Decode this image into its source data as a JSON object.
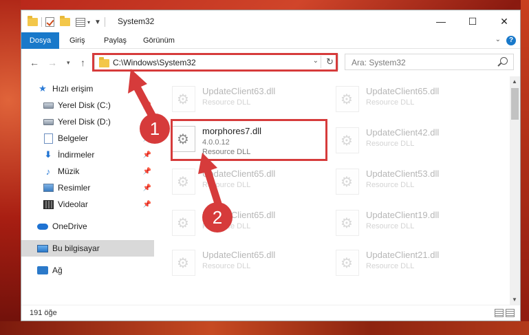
{
  "window": {
    "title": "System32",
    "controls": {
      "minimize": "—",
      "maximize": "☐",
      "close": "✕"
    }
  },
  "ribbon": {
    "tabs": [
      "Dosya",
      "Giriş",
      "Paylaş",
      "Görünüm"
    ],
    "help": "?"
  },
  "address": {
    "path": "C:\\Windows\\System32",
    "search_placeholder": "Ara: System32"
  },
  "navpane": {
    "items": [
      {
        "label": "Hızlı erişim",
        "icon": "star-icon"
      },
      {
        "label": "Yerel Disk (C:)",
        "icon": "drive-icon",
        "pinned": true
      },
      {
        "label": "Yerel Disk (D:)",
        "icon": "drive-icon",
        "pinned": true
      },
      {
        "label": "Belgeler",
        "icon": "documents-icon",
        "pinned": true
      },
      {
        "label": "İndirmeler",
        "icon": "downloads-icon",
        "pinned": true
      },
      {
        "label": "Müzik",
        "icon": "music-icon",
        "pinned": true
      },
      {
        "label": "Resimler",
        "icon": "pictures-icon",
        "pinned": true
      },
      {
        "label": "Videolar",
        "icon": "videos-icon",
        "pinned": true
      },
      {
        "label": "OneDrive",
        "icon": "onedrive-icon"
      },
      {
        "label": "Bu bilgisayar",
        "icon": "this-pc-icon",
        "selected": true
      },
      {
        "label": "Ağ",
        "icon": "network-icon"
      }
    ]
  },
  "files": {
    "selected": {
      "name": "morphores7.dll",
      "version": "4.0.0.12",
      "type": "Resource DLL"
    },
    "ghosts": [
      {
        "name": "UpdateClient63.dll",
        "type": "Resource DLL"
      },
      {
        "name": "UpdateClient65.dll",
        "type": "Resource DLL"
      },
      {
        "name": "UpdateClient42.dll",
        "type": "Resource DLL"
      },
      {
        "name": "UpdateClient65.dll",
        "type": "Resource DLL"
      },
      {
        "name": "UpdateClient53.dll",
        "type": "Resource DLL"
      },
      {
        "name": "UpdateClient65.dll",
        "type": "Resource DLL"
      },
      {
        "name": "UpdateClient19.dll",
        "type": "Resource DLL"
      },
      {
        "name": "UpdateClient65.dll",
        "type": "Resource DLL"
      },
      {
        "name": "UpdateClient21.dll",
        "type": "Resource DLL"
      }
    ]
  },
  "status": {
    "count": "191 öğe"
  },
  "annotations": {
    "step1": "1",
    "step2": "2",
    "color": "#d63b3b"
  }
}
